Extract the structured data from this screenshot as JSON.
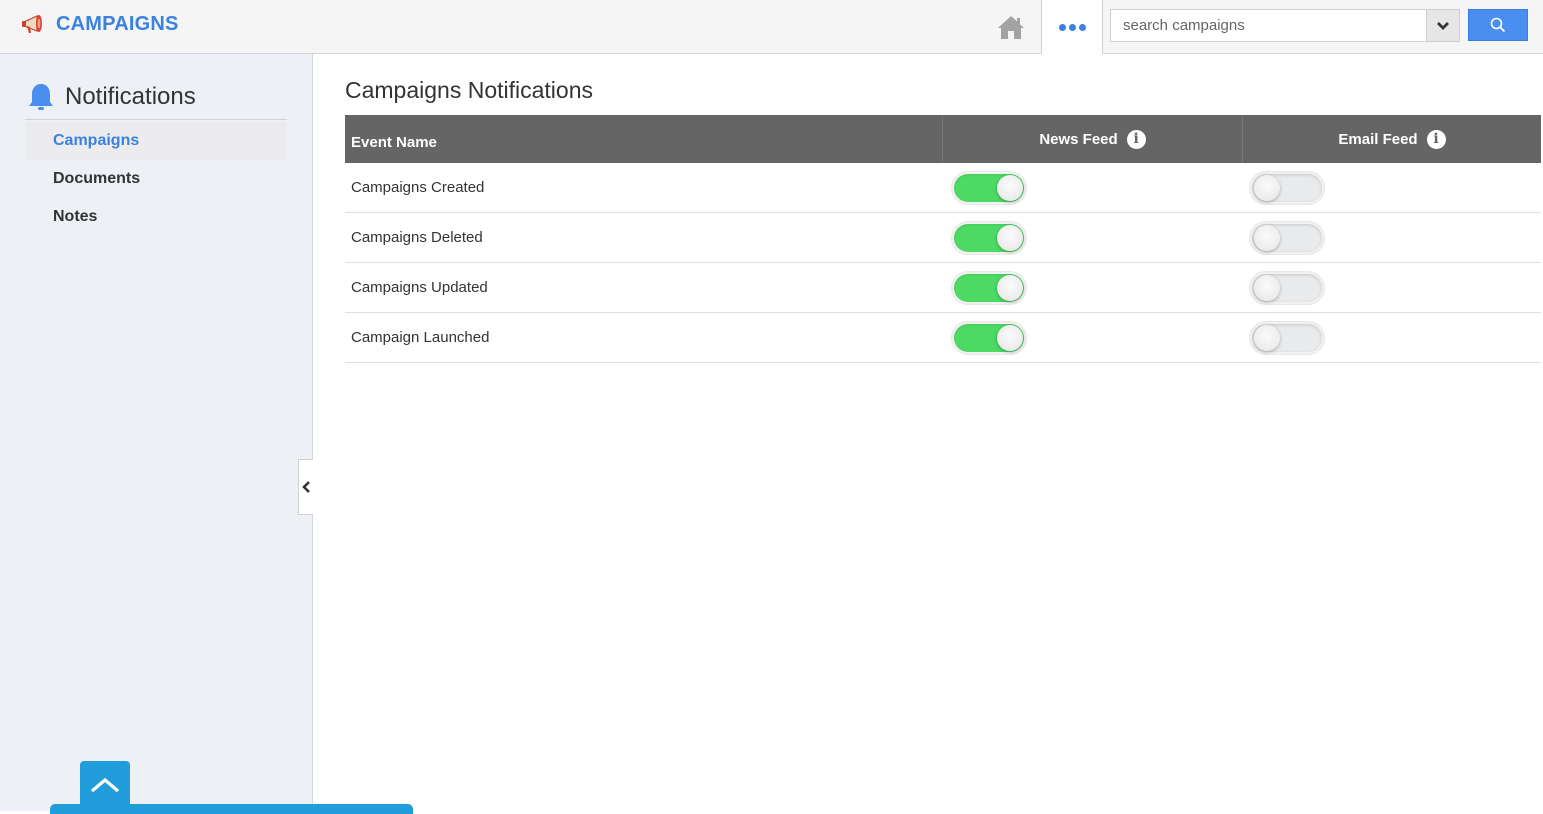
{
  "app": {
    "title": "CAMPAIGNS",
    "logo_icon": "megaphone-icon",
    "brand_color": "#3b82e0"
  },
  "topbar": {
    "home_icon": "home-icon",
    "more_icon": "more-dots-icon",
    "search": {
      "placeholder": "search campaigns",
      "value": "",
      "dropdown_icon": "chevron-down-icon",
      "button_icon": "search-icon"
    }
  },
  "sidebar": {
    "header": {
      "icon": "bell-icon",
      "label": "Notifications"
    },
    "items": [
      {
        "label": "Campaigns",
        "active": true
      },
      {
        "label": "Documents",
        "active": false
      },
      {
        "label": "Notes",
        "active": false
      }
    ],
    "collapse_icon": "chevron-left-icon",
    "scroll_top_icon": "chevron-up-icon"
  },
  "main": {
    "title": "Campaigns Notifications",
    "table": {
      "columns": [
        {
          "label": "Event Name"
        },
        {
          "label": "News Feed",
          "info_icon": "info-icon"
        },
        {
          "label": "Email Feed",
          "info_icon": "info-icon"
        }
      ],
      "rows": [
        {
          "event": "Campaigns Created",
          "news_feed": true,
          "email_feed": false
        },
        {
          "event": "Campaigns Deleted",
          "news_feed": true,
          "email_feed": false
        },
        {
          "event": "Campaigns Updated",
          "news_feed": true,
          "email_feed": false
        },
        {
          "event": "Campaign Launched",
          "news_feed": true,
          "email_feed": false
        }
      ]
    }
  },
  "colors": {
    "toggle_on": "#4cd964",
    "toggle_off": "#e9eaec",
    "header_bg": "#656565",
    "accent_blue": "#219ddc"
  }
}
